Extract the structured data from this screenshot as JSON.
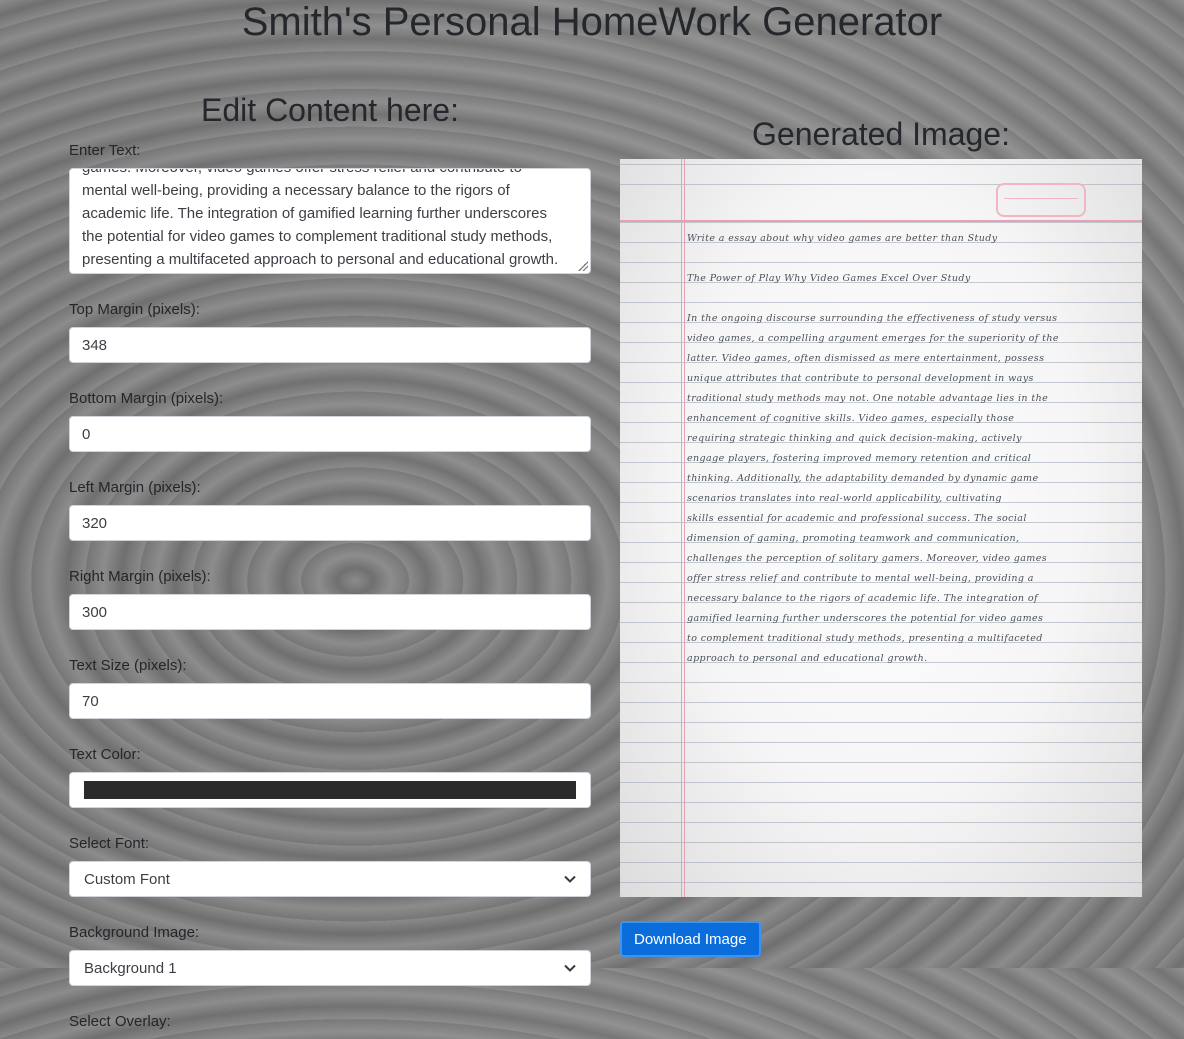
{
  "app": {
    "title": "Smith's Personal HomeWork Generator"
  },
  "editor": {
    "heading": "Edit Content here:",
    "text_label": "Enter Text:",
    "text_lines": [
      "games. Moreover, video games offer stress relief and contribute to",
      "mental well-being, providing a necessary balance to the rigors of",
      "academic life. The integration of gamified learning further underscores",
      "the potential for video games to complement traditional study methods,",
      "presenting a multifaceted approach to personal and educational growth."
    ],
    "top_margin_label": "Top Margin (pixels):",
    "top_margin_value": "348",
    "bottom_margin_label": "Bottom Margin (pixels):",
    "bottom_margin_value": "0",
    "left_margin_label": "Left Margin (pixels):",
    "left_margin_value": "320",
    "right_margin_label": "Right Margin (pixels):",
    "right_margin_value": "300",
    "text_size_label": "Text Size (pixels):",
    "text_size_value": "70",
    "text_color_label": "Text Color:",
    "text_color_value": "#2b2b2b",
    "font_label": "Select Font:",
    "font_value": "Custom Font",
    "background_label": "Background Image:",
    "background_value": "Background 1",
    "overlay_label": "Select Overlay:"
  },
  "preview": {
    "heading": "Generated Image:",
    "lines": [
      "Write a essay about why video games are better than Study",
      "",
      "The Power of Play Why Video Games Excel Over Study",
      "",
      "In the ongoing discourse surrounding the effectiveness of study versus",
      "video games, a compelling argument emerges for the superiority of the",
      "latter. Video games, often dismissed as mere entertainment, possess",
      "unique attributes that contribute to personal development in ways",
      "traditional study methods may not. One notable advantage lies in the",
      "enhancement of cognitive skills. Video games, especially those",
      "requiring strategic thinking and quick decision-making, actively",
      "engage players, fostering improved memory retention and critical",
      "thinking. Additionally, the adaptability demanded by dynamic game",
      "scenarios translates into real-world applicability, cultivating",
      "skills essential for academic and professional success. The social",
      "dimension of gaming, promoting teamwork and communication,",
      "challenges the perception of solitary gamers. Moreover, video games",
      "offer stress relief and contribute to mental well-being, providing a",
      "necessary balance to the rigors of academic life. The integration of",
      "gamified learning further underscores the potential for video games",
      "to complement traditional study methods, presenting a multifaceted",
      "approach to personal and educational growth."
    ],
    "download_label": "Download Image"
  },
  "icons": {
    "select_chevron": "chevron-down-icon",
    "resize": "resize-grip-icon"
  }
}
